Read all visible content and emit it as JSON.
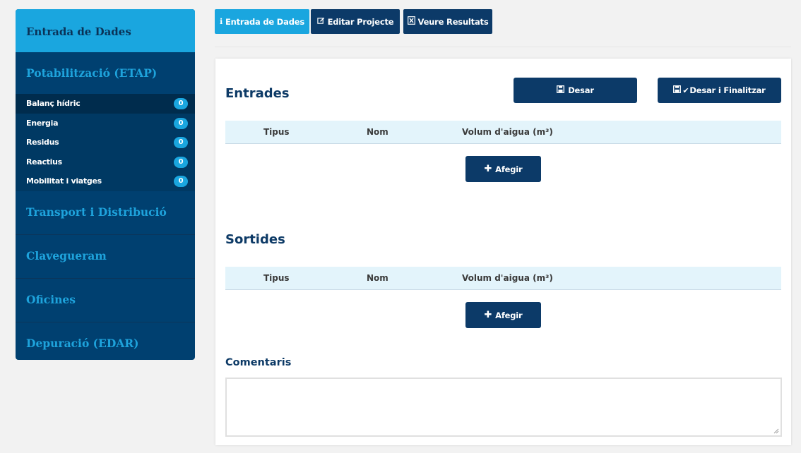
{
  "sidebar": {
    "header": "Entrada de Dades",
    "section_etap": "Potabilització (ETAP)",
    "items": [
      {
        "label": "Balanç hídric",
        "count": "0"
      },
      {
        "label": "Energia",
        "count": "0"
      },
      {
        "label": "Residus",
        "count": "0"
      },
      {
        "label": "Reactius",
        "count": "0"
      },
      {
        "label": "Mobilitat i viatges",
        "count": "0"
      }
    ],
    "section_transport": "Transport i Distribució",
    "section_clavegueram": "Clavegueram",
    "section_oficines": "Oficines",
    "section_depuracio": "Depuració (EDAR)"
  },
  "tabs": {
    "entrada": "Entrada de Dades",
    "editar": "Editar Projecte",
    "veure": "Veure Resultats"
  },
  "main": {
    "entrades_title": "Entrades",
    "save_label": "Desar",
    "save_finish_label": "Desar i Finalitzar",
    "sortides_title": "Sortides",
    "columns": [
      "Tipus",
      "Nom",
      "Volum d'aigua (m³)"
    ],
    "add_label": "Afegir",
    "comments_label": "Comentaris",
    "comments_value": ""
  },
  "colors": {
    "accent": "#1aa6df",
    "navy": "#0c3a68",
    "sidebar": "#004070"
  },
  "icons": [
    "info-icon",
    "edit-icon",
    "excel-icon",
    "save-icon",
    "check-icon",
    "plus-icon"
  ]
}
